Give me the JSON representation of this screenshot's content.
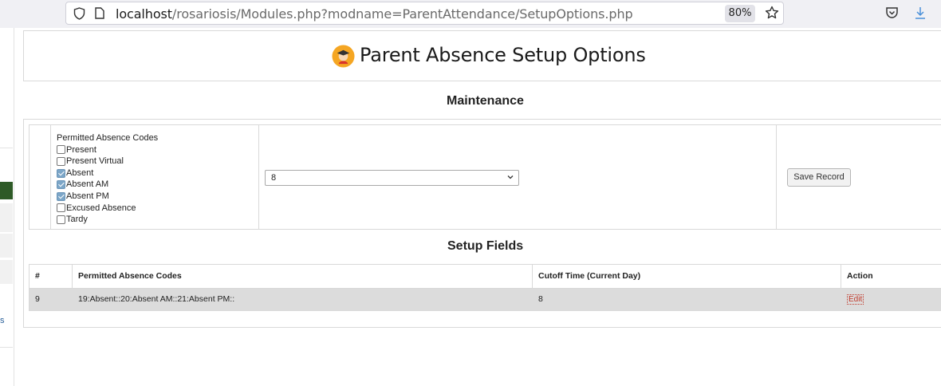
{
  "browser": {
    "url_host": "localhost",
    "url_path": "/rosariosis/Modules.php?modname=ParentAttendance/SetupOptions.php",
    "zoom": "80%",
    "icons": [
      "shield-icon",
      "page-icon",
      "star-icon",
      "pocket-icon",
      "download-icon"
    ]
  },
  "sidebar": {
    "partial_text": "s"
  },
  "page": {
    "title": "Parent Absence Setup Options",
    "title_icon": "graduate-avatar-icon"
  },
  "maintenance": {
    "heading": "Maintenance",
    "codes_label": "Permitted Absence Codes",
    "codes": [
      {
        "label": "Present",
        "checked": false
      },
      {
        "label": "Present Virtual",
        "checked": false
      },
      {
        "label": "Absent",
        "checked": true
      },
      {
        "label": "Absent AM",
        "checked": true
      },
      {
        "label": "Absent PM",
        "checked": true
      },
      {
        "label": "Excused Absence",
        "checked": false
      },
      {
        "label": "Tardy",
        "checked": false
      }
    ],
    "cutoff_select_value": "8",
    "save_label": "Save Record"
  },
  "setup_fields": {
    "heading": "Setup Fields",
    "columns": [
      "#",
      "Permitted Absence Codes",
      "Cutoff Time (Current Day)",
      "Action"
    ],
    "rows": [
      {
        "num": "9",
        "codes": "19:Absent::20:Absent AM::21:Absent PM::",
        "cutoff": "8",
        "action": "Edit"
      }
    ]
  },
  "colors": {
    "accent_green": "#2e5a27",
    "row_bg": "#dcdcdc",
    "edit_link": "#c0392b",
    "checkbox_checked": "#7ca6c8"
  }
}
